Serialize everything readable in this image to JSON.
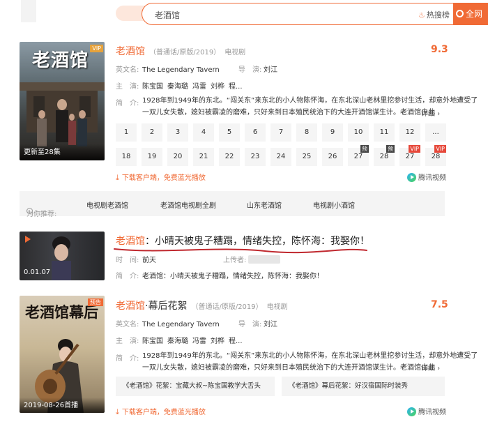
{
  "search": {
    "value": "老酒馆",
    "hot_label": "热搜榜",
    "button_label": "全网"
  },
  "result1": {
    "title": "老酒馆",
    "meta": "（普通话/原版/2019）",
    "type": "电视剧",
    "score": "9.3",
    "badge": "VIP",
    "update": "更新至28集",
    "en_label": "英文名:",
    "en_value": "The Legendary Tavern",
    "director_label": "导　演:",
    "director": "刘江",
    "cast_label": "主　演:",
    "cast": [
      "陈宝国",
      "秦海璐",
      "冯雷",
      "刘桦",
      "程..."
    ],
    "intro_label": "简　介:",
    "intro_line1": "1928年到1949年的东北。“闯关东”来东北的小人物陈怀海，在东北深山老林里挖参讨生活，却意外地遭受了",
    "intro_line2": "一双儿女失散，媳妇被霸凌的磨难，只好来到日本殖民统治下的大连开酒馆谋生计。老酒馆由此",
    "detail": "详细 ›",
    "episodes": [
      {
        "n": "1"
      },
      {
        "n": "2"
      },
      {
        "n": "3"
      },
      {
        "n": "4"
      },
      {
        "n": "5"
      },
      {
        "n": "6"
      },
      {
        "n": "7"
      },
      {
        "n": "8"
      },
      {
        "n": "9"
      },
      {
        "n": "10"
      },
      {
        "n": "11"
      },
      {
        "n": "12"
      },
      {
        "n": "..."
      },
      {
        "n": "18"
      },
      {
        "n": "19"
      },
      {
        "n": "20"
      },
      {
        "n": "21"
      },
      {
        "n": "22"
      },
      {
        "n": "23"
      },
      {
        "n": "24"
      },
      {
        "n": "25"
      },
      {
        "n": "26"
      },
      {
        "n": "27",
        "tag": "预"
      },
      {
        "n": "28",
        "tag": "预"
      },
      {
        "n": "27",
        "tag": "VIP"
      },
      {
        "n": "28",
        "tag": "VIP"
      }
    ],
    "download": "下载客户端，免费蓝光播放",
    "source": "腾讯视频"
  },
  "recommend": {
    "label": "为你推荐:",
    "items": [
      "电视剧老酒馆",
      "老酒馆电视剧全剧",
      "山东老酒馆",
      "电视剧小酒馆"
    ]
  },
  "result2": {
    "title_prefix": "老酒馆",
    "title_rest": "：小晴天被鬼子糟蹋，情绪失控，陈怀海：我娶你！",
    "duration": "0.01.07",
    "time_label": "时　间:",
    "time_value": "前天",
    "uploader_label": "上传者:",
    "intro_label": "简　介:",
    "intro": "老酒馆：小晴天被鬼子糟蹋，情绪失控，陈怀海：我娶你！"
  },
  "result3": {
    "title_prefix": "老酒馆",
    "title_rest": "·幕后花絮",
    "meta": "（普通话/原版/2019）",
    "type": "电视剧",
    "score": "7.5",
    "badge": "预告",
    "poster_text": "老酒馆幕后",
    "date": "2019-08-26首播",
    "en_label": "英文名:",
    "en_value": "The Legendary Tavern",
    "director_label": "导　演:",
    "director": "刘江",
    "cast_label": "主　演:",
    "cast": [
      "陈宝国",
      "秦海璐",
      "冯雷",
      "刘桦",
      "程..."
    ],
    "intro_label": "简　介:",
    "intro_line1": "1928年到1949年的东北。“闯关东”来东北的小人物陈怀海，在东北深山老林里挖参讨生活，却意外地遭受了",
    "intro_line2": "一双儿女失散，媳妇被霸凌的磨难，只好来到日本殖民统治下的大连开酒馆谋生计。老酒馆由此",
    "detail": "详细 ›",
    "clips": [
      "《老酒馆》花絮：宝藏大叔~陈宝国教学大舌头",
      "《老酒馆》幕后花絮：好汉宿国际时装秀"
    ],
    "download": "下载客户端，免费蓝光播放",
    "source": "腾讯视频"
  },
  "colors": {
    "accent": "#f06a35",
    "vip": "#e6483a",
    "red_underline": "#c0282e"
  }
}
